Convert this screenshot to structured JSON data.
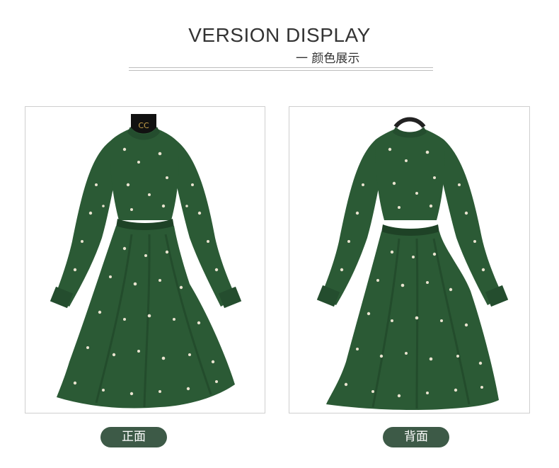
{
  "header": {
    "title": "VERSION DISPLAY",
    "subtitle": "一 颜色展示"
  },
  "colors": {
    "dress_green": "#2b5a35",
    "dress_dark": "#1e4226",
    "print_cream": "#e9e3cf",
    "label_bg": "#3d5a47",
    "rule": "#bdbdbd"
  },
  "panels": [
    {
      "label": "正面",
      "logo_text": "CC"
    },
    {
      "label": "背面"
    }
  ]
}
